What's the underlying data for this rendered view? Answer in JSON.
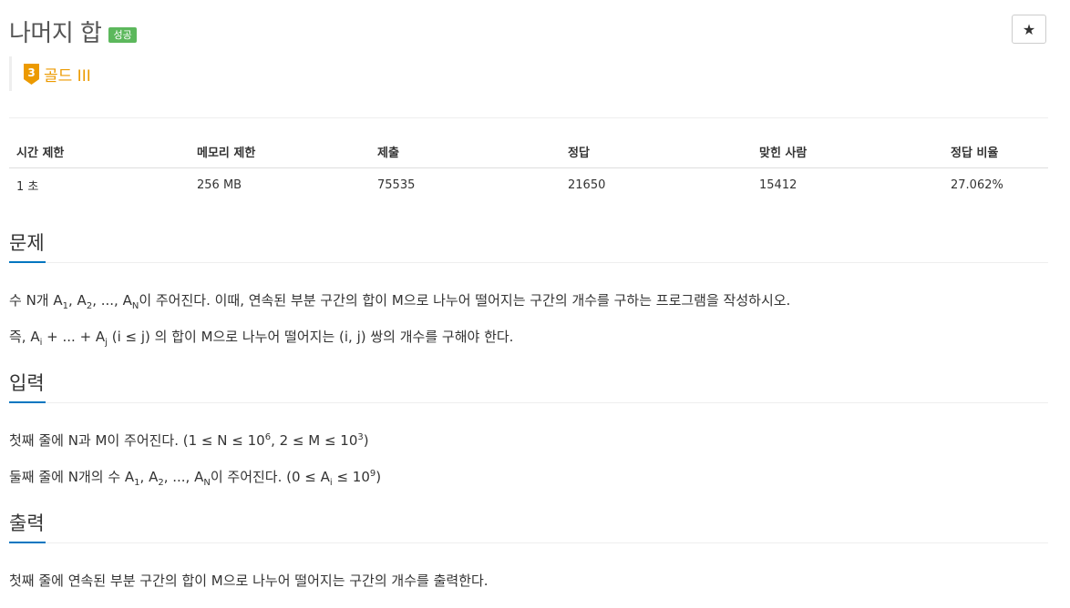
{
  "problem": {
    "title": "나머지 합",
    "status_badge": "성공",
    "star": "★",
    "tier": {
      "number": "3",
      "label": "골드 III",
      "color": "#ec9a00"
    }
  },
  "info_table": {
    "headers": [
      "시간 제한",
      "메모리 제한",
      "제출",
      "정답",
      "맞힌 사람",
      "정답 비율"
    ],
    "values": [
      "1 초",
      "256 MB",
      "75535",
      "21650",
      "15412",
      "27.062%"
    ]
  },
  "sections": {
    "description": {
      "heading": "문제",
      "p1": {
        "prefix": "수 N개 A",
        "s1": "1",
        "mid1": ", A",
        "s2": "2",
        "mid2": ", ..., A",
        "sN": "N",
        "suffix": "이 주어진다. 이때, 연속된 부분 구간의 합이 M으로 나누어 떨어지는 구간의 개수를 구하는 프로그램을 작성하시오."
      },
      "p2": {
        "prefix": "즉, A",
        "si": "i",
        "mid": " + ... + A",
        "sj": "j",
        "suffix": " (i ≤ j) 의 합이 M으로 나누어 떨어지는 (i, j) 쌍의 개수를 구해야 한다."
      }
    },
    "input": {
      "heading": "입력",
      "p1": {
        "prefix": "첫째 줄에 N과 M이 주어진다. (1 ≤ N ≤ 10",
        "e1": "6",
        "mid": ", 2 ≤ M ≤ 10",
        "e2": "3",
        "suffix": ")"
      },
      "p2": {
        "prefix": "둘째 줄에 N개의 수 A",
        "s1": "1",
        "mid1": ", A",
        "s2": "2",
        "mid2": ", ..., A",
        "sN": "N",
        "mid3": "이 주어진다. (0 ≤ A",
        "si": "i",
        "mid4": " ≤ 10",
        "e": "9",
        "suffix": ")"
      }
    },
    "output": {
      "heading": "출력",
      "p1": "첫째 줄에 연속된 부분 구간의 합이 M으로 나누어 떨어지는 구간의 개수를 출력한다."
    }
  }
}
